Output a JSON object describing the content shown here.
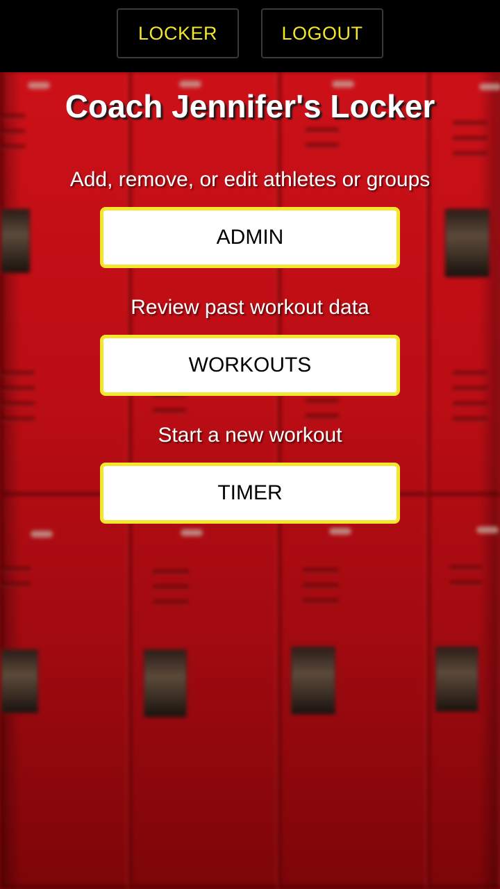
{
  "nav": {
    "locker_label": "LOCKER",
    "logout_label": "LOGOUT"
  },
  "page": {
    "title": "Coach Jennifer's Locker"
  },
  "sections": {
    "admin": {
      "caption": "Add, remove, or edit athletes or groups",
      "button_label": "ADMIN"
    },
    "workouts": {
      "caption": "Review past workout data",
      "button_label": "WORKOUTS"
    },
    "timer": {
      "caption": "Start a new workout",
      "button_label": "TIMER"
    }
  },
  "colors": {
    "accent": "#f4e62b",
    "topbar_bg": "#000000",
    "locker_red": "#c0101a",
    "button_bg": "#ffffff"
  },
  "background": "red-school-lockers-image"
}
